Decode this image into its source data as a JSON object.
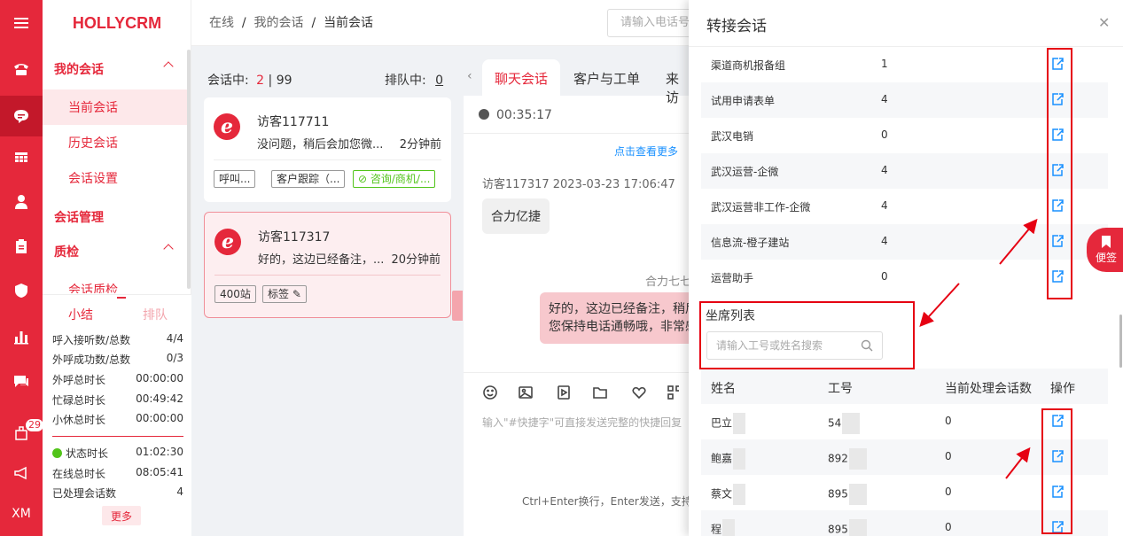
{
  "rail": {
    "items": [
      "phone-icon",
      "chat-icon",
      "grid-icon",
      "user-icon",
      "clipboard-icon",
      "shield-icon",
      "bar-chart-icon",
      "message-icon",
      "notification-icon",
      "megaphone-icon"
    ],
    "notification_badge": "29",
    "user_short": "XM"
  },
  "sidebar": {
    "brand": "HOLLYCRM",
    "group_my_sessions": "我的会话",
    "item_current": "当前会话",
    "item_history": "历史会话",
    "item_settings": "会话设置",
    "group_manage": "会话管理",
    "group_qc": "质检",
    "item_qc": "会话质检"
  },
  "stats": {
    "tab_summary": "小结",
    "tab_queue": "排队",
    "rows1": [
      {
        "label": "呼入接听数/总数",
        "value": "4/4"
      },
      {
        "label": "外呼成功数/总数",
        "value": "0/3"
      },
      {
        "label": "外呼总时长",
        "value": "00:00:00"
      },
      {
        "label": "忙碌总时长",
        "value": "00:49:42"
      },
      {
        "label": "小休总时长",
        "value": "00:00:00"
      }
    ],
    "rows2": [
      {
        "label": "状态时长",
        "value": "01:02:30"
      },
      {
        "label": "在线总时长",
        "value": "08:05:41"
      },
      {
        "label": "已处理会话数",
        "value": "4"
      }
    ],
    "more": "更多"
  },
  "topbar": {
    "crumb1": "在线",
    "crumb2": "我的会话",
    "crumb3": "当前会话",
    "sep": "/",
    "search_placeholder": "请输入电话号"
  },
  "queue": {
    "in_session_label": "会话中:",
    "in_session_count": "2",
    "in_session_total": "| 99",
    "queue_label": "排队中:",
    "queue_count": "0",
    "cards": [
      {
        "name": "访客117711",
        "msg": "没问题，稍后会加您微...",
        "time": "2分钟前",
        "tags": [
          "呼叫...",
          "客户跟踪（...",
          "⊘ 咨询/商机/..."
        ]
      },
      {
        "name": "访客117317",
        "msg": "好的，这边已经备注，...",
        "time": "20分钟前",
        "tags": [
          "400站",
          "标签 ✎"
        ]
      }
    ]
  },
  "chat": {
    "tabs": [
      "聊天会话",
      "客户与工单",
      "来访"
    ],
    "timer": "00:35:17",
    "see_more": "点击查看更多",
    "visitor_meta": "访客117317 2023-03-23 17:06:47",
    "visitor_msg": "合力亿捷",
    "agent_meta": "合力七七",
    "agent_msg_1": "好的，这边已经备注，稍后",
    "agent_msg_2": "您保持电话通畅哦，非常感",
    "input_placeholder": "输入\"#快捷字\"可直接发送完整的快捷回复",
    "send_hint": "Ctrl+Enter换行，Enter发送，支持粘"
  },
  "drawer": {
    "title": "转接会话",
    "groups": [
      {
        "name": "渠道商机报备组",
        "count": "1"
      },
      {
        "name": "试用申请表单",
        "count": "4"
      },
      {
        "name": "武汉电销",
        "count": "0"
      },
      {
        "name": "武汉运营-企微",
        "count": "4"
      },
      {
        "name": "武汉运营非工作-企微",
        "count": "4"
      },
      {
        "name": "信息流-橙子建站",
        "count": "4"
      },
      {
        "name": "运营助手",
        "count": "0"
      }
    ],
    "seat_title": "坐席列表",
    "seat_placeholder": "请输入工号或姓名搜索",
    "headers": {
      "name": "姓名",
      "id": "工号",
      "current": "当前处理会话数",
      "op": "操作"
    },
    "agents": [
      {
        "name": "巴立",
        "id": "54",
        "current": "0"
      },
      {
        "name": "鲍嘉",
        "id": "892",
        "current": "0"
      },
      {
        "name": "蔡文",
        "id": "895",
        "current": "0"
      },
      {
        "name": "程",
        "id": "895",
        "current": "0"
      }
    ]
  },
  "float_note": "便签",
  "colors": {
    "brand_red": "#e5283b",
    "link_blue": "#1890ff",
    "annotation_red": "#e60012"
  }
}
